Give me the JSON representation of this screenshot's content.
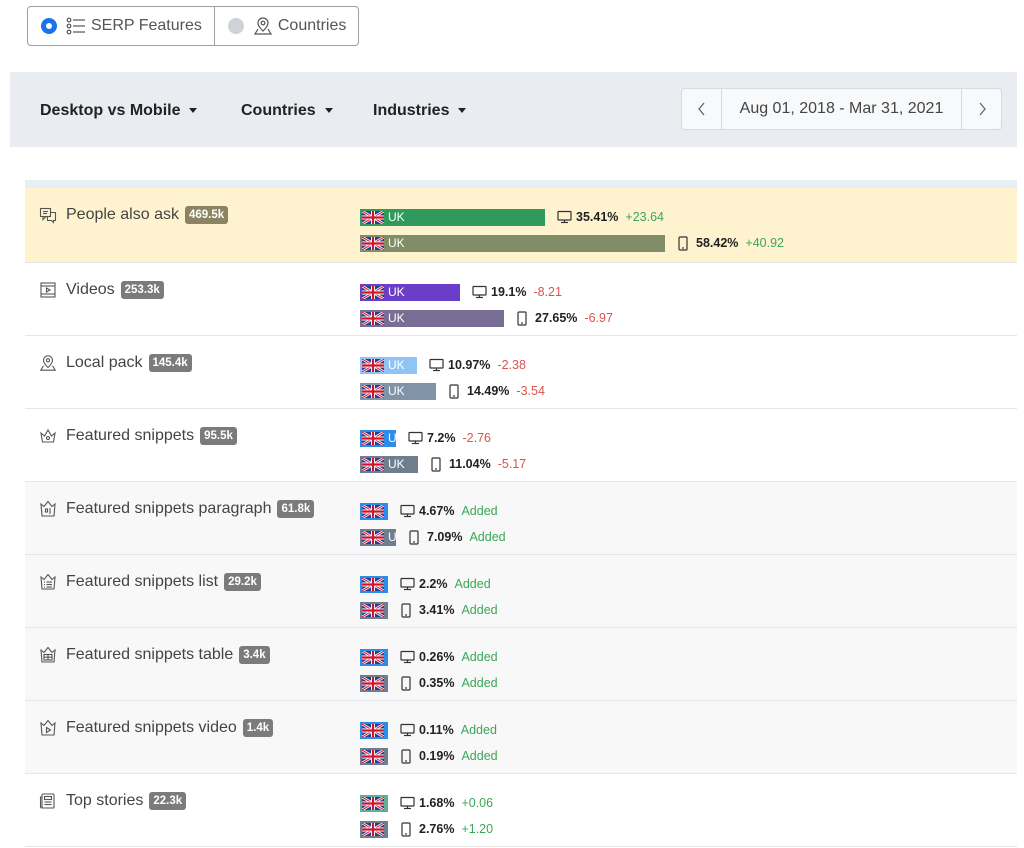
{
  "toggles": [
    {
      "label": "SERP Features",
      "active": true
    },
    {
      "label": "Countries",
      "active": false
    }
  ],
  "filters": {
    "device": "Desktop vs Mobile",
    "countries": "Countries",
    "industries": "Industries"
  },
  "date_range": "Aug 01, 2018 - Mar 31, 2021",
  "colors": {
    "active_radio": "#1a73e8",
    "positive": "#3aa757",
    "negative": "#d9534f",
    "highlight_row": "#fff3cf"
  },
  "features": [
    {
      "name": "People also ask",
      "icon": "qa-icon",
      "count": "469.5k",
      "highlight": true,
      "desktop": {
        "country": "UK",
        "percent": "35.41%",
        "fraction": 0.3541,
        "delta": "+23.64",
        "color": "#2f9a5c"
      },
      "mobile": {
        "country": "UK",
        "percent": "58.42%",
        "fraction": 0.5842,
        "delta": "+40.92",
        "color": "#7f8e67"
      }
    },
    {
      "name": "Videos",
      "icon": "video-icon",
      "count": "253.3k",
      "desktop": {
        "country": "UK",
        "percent": "19.1%",
        "fraction": 0.191,
        "delta": "-8.21",
        "color": "#6b3ec9"
      },
      "mobile": {
        "country": "UK",
        "percent": "27.65%",
        "fraction": 0.2765,
        "delta": "-6.97",
        "color": "#786d95"
      }
    },
    {
      "name": "Local pack",
      "icon": "map-pin-icon",
      "count": "145.4k",
      "desktop": {
        "country": "UK",
        "percent": "10.97%",
        "fraction": 0.1097,
        "delta": "-2.38",
        "color": "#8fc4f5"
      },
      "mobile": {
        "country": "UK",
        "percent": "14.49%",
        "fraction": 0.1449,
        "delta": "-3.54",
        "color": "#8193a7"
      }
    },
    {
      "name": "Featured snippets",
      "icon": "crown-icon",
      "count": "95.5k",
      "desktop": {
        "country": "U",
        "percent": "7.2%",
        "fraction": 0.072,
        "delta": "-2.76",
        "color": "#2b8de8"
      },
      "mobile": {
        "country": "UK",
        "percent": "11.04%",
        "fraction": 0.1104,
        "delta": "-5.17",
        "color": "#6f7e8f"
      }
    },
    {
      "name": "Featured snippets paragraph",
      "icon": "crown-paragraph-icon",
      "count": "61.8k",
      "alt": true,
      "desktop": {
        "country": "",
        "percent": "4.67%",
        "fraction": 0.0467,
        "delta": "Added",
        "color": "#2b8de8"
      },
      "mobile": {
        "country": "U",
        "percent": "7.09%",
        "fraction": 0.0709,
        "delta": "Added",
        "color": "#6f7e8f"
      }
    },
    {
      "name": "Featured snippets list",
      "icon": "crown-list-icon",
      "count": "29.2k",
      "alt": true,
      "desktop": {
        "country": "",
        "percent": "2.2%",
        "fraction": 0.022,
        "delta": "Added",
        "color": "#2b8de8"
      },
      "mobile": {
        "country": "",
        "percent": "3.41%",
        "fraction": 0.0341,
        "delta": "Added",
        "color": "#6f7e8f"
      }
    },
    {
      "name": "Featured snippets table",
      "icon": "crown-table-icon",
      "count": "3.4k",
      "alt": true,
      "desktop": {
        "country": "",
        "percent": "0.26%",
        "fraction": 0.0026,
        "delta": "Added",
        "color": "#2b8de8"
      },
      "mobile": {
        "country": "",
        "percent": "0.35%",
        "fraction": 0.0035,
        "delta": "Added",
        "color": "#6f7e8f"
      }
    },
    {
      "name": "Featured snippets video",
      "icon": "crown-video-icon",
      "count": "1.4k",
      "alt": true,
      "desktop": {
        "country": "",
        "percent": "0.11%",
        "fraction": 0.0011,
        "delta": "Added",
        "color": "#2b8de8"
      },
      "mobile": {
        "country": "",
        "percent": "0.19%",
        "fraction": 0.0019,
        "delta": "Added",
        "color": "#6f7e8f"
      }
    },
    {
      "name": "Top stories",
      "icon": "newspaper-icon",
      "count": "22.3k",
      "desktop": {
        "country": "",
        "percent": "1.68%",
        "fraction": 0.0168,
        "delta": "+0.06",
        "color": "#5fae98"
      },
      "mobile": {
        "country": "",
        "percent": "2.76%",
        "fraction": 0.0276,
        "delta": "+1.20",
        "color": "#6f7e8f"
      }
    }
  ]
}
